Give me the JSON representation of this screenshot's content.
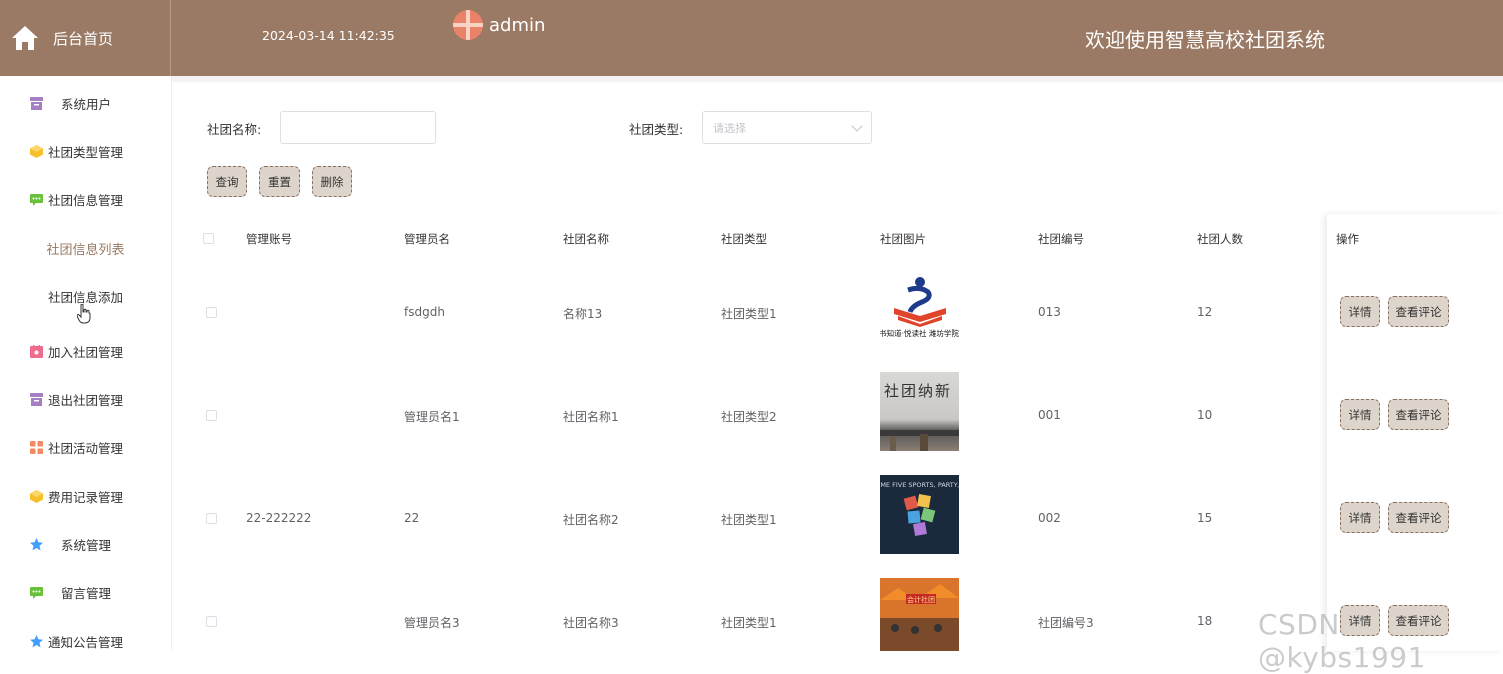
{
  "header": {
    "home_label": "后台首页",
    "datetime": "2024-03-14 11:42:35",
    "username": "admin",
    "welcome": "欢迎使用智慧高校社团系统"
  },
  "sidebar": {
    "items": [
      {
        "label": "系统用户",
        "icon": "archive-icon",
        "color": "#a57fc0"
      },
      {
        "label": "社团类型管理",
        "icon": "cube-icon",
        "color": "#f7c02b"
      },
      {
        "label": "社团信息管理",
        "icon": "message-icon",
        "color": "#67c23a"
      },
      {
        "label": "社团信息列表",
        "sub": true,
        "active": true
      },
      {
        "label": "社团信息添加",
        "sub": true
      },
      {
        "label": "加入社团管理",
        "icon": "calendar-icon",
        "color": "#f06c8f"
      },
      {
        "label": "退出社团管理",
        "icon": "archive-icon",
        "color": "#a57fc0"
      },
      {
        "label": "社团活动管理",
        "icon": "grid-icon",
        "color": "#f28a63"
      },
      {
        "label": "费用记录管理",
        "icon": "cube-icon",
        "color": "#f7c02b"
      },
      {
        "label": "系统管理",
        "icon": "star-icon",
        "color": "#409eff"
      },
      {
        "label": "留言管理",
        "icon": "message-icon",
        "color": "#67c23a"
      },
      {
        "label": "通知公告管理",
        "icon": "star-icon",
        "color": "#409eff"
      }
    ]
  },
  "search": {
    "name_label": "社团名称:",
    "name_value": "",
    "type_label": "社团类型:",
    "type_placeholder": "请选择"
  },
  "toolbar": {
    "query": "查询",
    "reset": "重置",
    "delete": "删除"
  },
  "table": {
    "columns": [
      "管理账号",
      "管理员名",
      "社团名称",
      "社团类型",
      "社团图片",
      "社团编号",
      "社团人数",
      "操作"
    ],
    "rows": [
      {
        "account": "",
        "admin": "fsdgdh",
        "name": "名称13",
        "type": "社团类型1",
        "image_text": "书知道·悦读社\n潍坊学院",
        "code": "013",
        "count": "12"
      },
      {
        "account": "",
        "admin": "管理员名1",
        "name": "社团名称1",
        "type": "社团类型2",
        "image_text": "社团纳新",
        "code": "001",
        "count": "10"
      },
      {
        "account": "22-222222",
        "admin": "22",
        "name": "社团名称2",
        "type": "社团类型1",
        "image_text": "GIVE ME FIVE\nSPORTS, PARTY, FUN",
        "code": "002",
        "count": "15"
      },
      {
        "account": "",
        "admin": "管理员名3",
        "name": "社团名称3",
        "type": "社团类型1",
        "image_text": "会计社团",
        "code": "社团编号3",
        "count": "18"
      }
    ],
    "actions": {
      "detail": "详情",
      "comments": "查看评论"
    }
  },
  "watermark": "CSDN @kybs1991",
  "colors": {
    "header": "#9a7a64",
    "active": "#9a7a64",
    "button_bg": "#ddd5cb",
    "button_border": "#8a7060"
  }
}
